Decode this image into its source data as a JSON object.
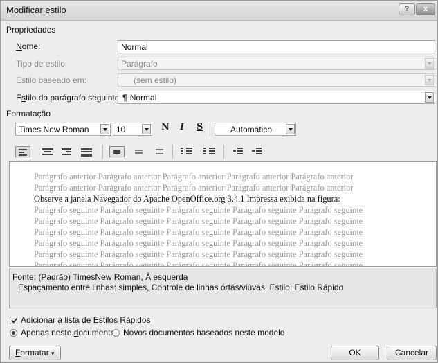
{
  "window": {
    "title": "Modificar estilo",
    "help_glyph": "?",
    "close_glyph": "x"
  },
  "properties": {
    "section_label": "Propriedades",
    "name_label": "Nome:",
    "name_value": "Normal",
    "style_type_label": "Tipo de estilo:",
    "style_type_value": "Parágrafo",
    "based_on_label": "Estilo baseado em:",
    "based_on_value": "(sem estilo)",
    "next_style_label": "Estilo do parágrafo seguinte:",
    "next_style_icon": "¶",
    "next_style_value": "Normal"
  },
  "formatting": {
    "section_label": "Formatação",
    "font": "Times New Roman",
    "size": "10",
    "bold": "N",
    "italic": "I",
    "underline": "S",
    "color": "Automático"
  },
  "preview": {
    "previous_lines": [
      "Parágrafo anterior Parágrafo anterior Parágrafo anterior Parágrafo anterior Parágrafo anterior",
      "Parágrafo anterior Parágrafo anterior Parágrafo anterior Parágrafo anterior Parágrafo anterior"
    ],
    "current_line": "Observe a janela Navegador do Apache OpenOffice.org 3.4.1 Impressa exibida na figura:",
    "next_lines": [
      "Parágrafo seguinte Parágrafo seguinte Parágrafo seguinte Parágrafo seguinte Parágrafo seguinte",
      "Parágrafo seguinte Parágrafo seguinte Parágrafo seguinte Parágrafo seguinte Parágrafo seguinte",
      "Parágrafo seguinte Parágrafo seguinte Parágrafo seguinte Parágrafo seguinte Parágrafo seguinte",
      "Parágrafo seguinte Parágrafo seguinte Parágrafo seguinte Parágrafo seguinte Parágrafo seguinte",
      "Parágrafo seguinte Parágrafo seguinte Parágrafo seguinte Parágrafo seguinte Parágrafo seguinte",
      "Parágrafo seguinte Parágrafo seguinte Parágrafo seguinte Parágrafo seguinte Parágrafo seguinte"
    ]
  },
  "description": {
    "line1": "Fonte: (Padrão) TimesNew Roman, À esquerda",
    "line2": "Espaçamento entre linhas: simples, Controle de linhas órfãs/viúvas. Estilo: Estilo Rápido"
  },
  "options": {
    "add_quick_styles": "Adicionar à lista de Estilos Rápidos",
    "only_this_doc": "Apenas neste documento",
    "new_docs": "Novos documentos baseados neste modelo"
  },
  "buttons": {
    "format": "Formatar",
    "format_arrow": "▾",
    "ok": "OK",
    "cancel": "Cancelar"
  }
}
